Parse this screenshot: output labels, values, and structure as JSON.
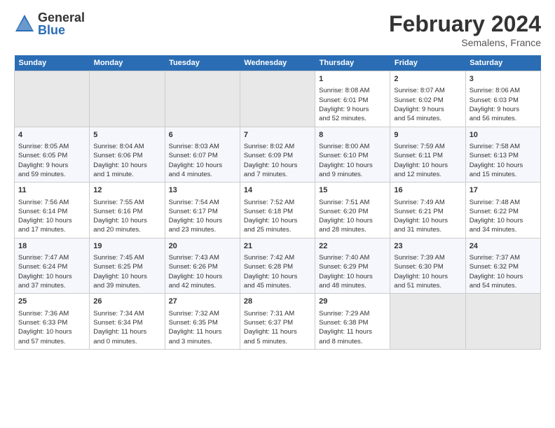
{
  "logo": {
    "general": "General",
    "blue": "Blue"
  },
  "title": "February 2024",
  "location": "Semalens, France",
  "days_of_week": [
    "Sunday",
    "Monday",
    "Tuesday",
    "Wednesday",
    "Thursday",
    "Friday",
    "Saturday"
  ],
  "weeks": [
    [
      {
        "day": "",
        "info": ""
      },
      {
        "day": "",
        "info": ""
      },
      {
        "day": "",
        "info": ""
      },
      {
        "day": "",
        "info": ""
      },
      {
        "day": "1",
        "info": "Sunrise: 8:08 AM\nSunset: 6:01 PM\nDaylight: 9 hours\nand 52 minutes."
      },
      {
        "day": "2",
        "info": "Sunrise: 8:07 AM\nSunset: 6:02 PM\nDaylight: 9 hours\nand 54 minutes."
      },
      {
        "day": "3",
        "info": "Sunrise: 8:06 AM\nSunset: 6:03 PM\nDaylight: 9 hours\nand 56 minutes."
      }
    ],
    [
      {
        "day": "4",
        "info": "Sunrise: 8:05 AM\nSunset: 6:05 PM\nDaylight: 9 hours\nand 59 minutes."
      },
      {
        "day": "5",
        "info": "Sunrise: 8:04 AM\nSunset: 6:06 PM\nDaylight: 10 hours\nand 1 minute."
      },
      {
        "day": "6",
        "info": "Sunrise: 8:03 AM\nSunset: 6:07 PM\nDaylight: 10 hours\nand 4 minutes."
      },
      {
        "day": "7",
        "info": "Sunrise: 8:02 AM\nSunset: 6:09 PM\nDaylight: 10 hours\nand 7 minutes."
      },
      {
        "day": "8",
        "info": "Sunrise: 8:00 AM\nSunset: 6:10 PM\nDaylight: 10 hours\nand 9 minutes."
      },
      {
        "day": "9",
        "info": "Sunrise: 7:59 AM\nSunset: 6:11 PM\nDaylight: 10 hours\nand 12 minutes."
      },
      {
        "day": "10",
        "info": "Sunrise: 7:58 AM\nSunset: 6:13 PM\nDaylight: 10 hours\nand 15 minutes."
      }
    ],
    [
      {
        "day": "11",
        "info": "Sunrise: 7:56 AM\nSunset: 6:14 PM\nDaylight: 10 hours\nand 17 minutes."
      },
      {
        "day": "12",
        "info": "Sunrise: 7:55 AM\nSunset: 6:16 PM\nDaylight: 10 hours\nand 20 minutes."
      },
      {
        "day": "13",
        "info": "Sunrise: 7:54 AM\nSunset: 6:17 PM\nDaylight: 10 hours\nand 23 minutes."
      },
      {
        "day": "14",
        "info": "Sunrise: 7:52 AM\nSunset: 6:18 PM\nDaylight: 10 hours\nand 25 minutes."
      },
      {
        "day": "15",
        "info": "Sunrise: 7:51 AM\nSunset: 6:20 PM\nDaylight: 10 hours\nand 28 minutes."
      },
      {
        "day": "16",
        "info": "Sunrise: 7:49 AM\nSunset: 6:21 PM\nDaylight: 10 hours\nand 31 minutes."
      },
      {
        "day": "17",
        "info": "Sunrise: 7:48 AM\nSunset: 6:22 PM\nDaylight: 10 hours\nand 34 minutes."
      }
    ],
    [
      {
        "day": "18",
        "info": "Sunrise: 7:47 AM\nSunset: 6:24 PM\nDaylight: 10 hours\nand 37 minutes."
      },
      {
        "day": "19",
        "info": "Sunrise: 7:45 AM\nSunset: 6:25 PM\nDaylight: 10 hours\nand 39 minutes."
      },
      {
        "day": "20",
        "info": "Sunrise: 7:43 AM\nSunset: 6:26 PM\nDaylight: 10 hours\nand 42 minutes."
      },
      {
        "day": "21",
        "info": "Sunrise: 7:42 AM\nSunset: 6:28 PM\nDaylight: 10 hours\nand 45 minutes."
      },
      {
        "day": "22",
        "info": "Sunrise: 7:40 AM\nSunset: 6:29 PM\nDaylight: 10 hours\nand 48 minutes."
      },
      {
        "day": "23",
        "info": "Sunrise: 7:39 AM\nSunset: 6:30 PM\nDaylight: 10 hours\nand 51 minutes."
      },
      {
        "day": "24",
        "info": "Sunrise: 7:37 AM\nSunset: 6:32 PM\nDaylight: 10 hours\nand 54 minutes."
      }
    ],
    [
      {
        "day": "25",
        "info": "Sunrise: 7:36 AM\nSunset: 6:33 PM\nDaylight: 10 hours\nand 57 minutes."
      },
      {
        "day": "26",
        "info": "Sunrise: 7:34 AM\nSunset: 6:34 PM\nDaylight: 11 hours\nand 0 minutes."
      },
      {
        "day": "27",
        "info": "Sunrise: 7:32 AM\nSunset: 6:35 PM\nDaylight: 11 hours\nand 3 minutes."
      },
      {
        "day": "28",
        "info": "Sunrise: 7:31 AM\nSunset: 6:37 PM\nDaylight: 11 hours\nand 5 minutes."
      },
      {
        "day": "29",
        "info": "Sunrise: 7:29 AM\nSunset: 6:38 PM\nDaylight: 11 hours\nand 8 minutes."
      },
      {
        "day": "",
        "info": ""
      },
      {
        "day": "",
        "info": ""
      }
    ]
  ]
}
